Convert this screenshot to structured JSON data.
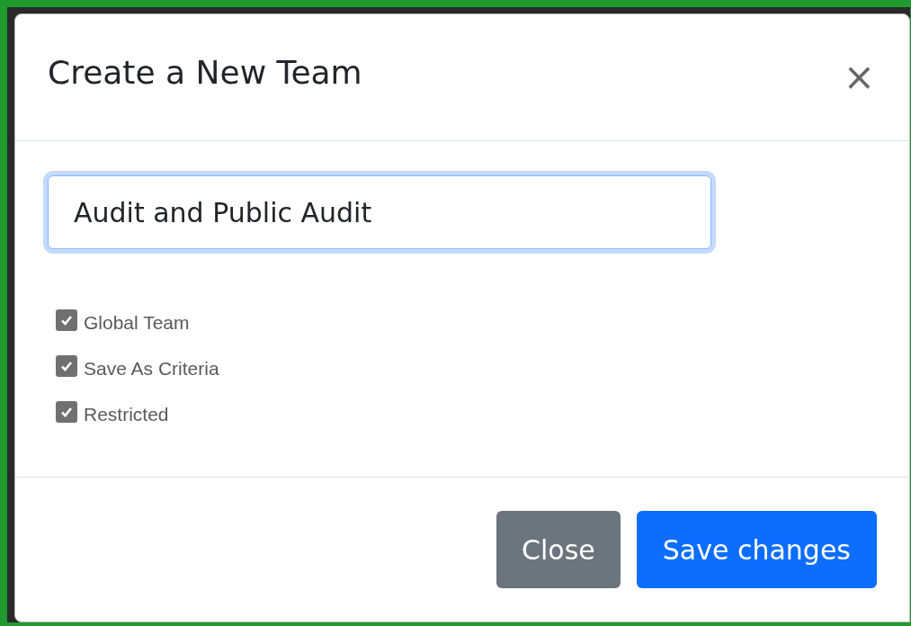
{
  "dialog": {
    "title": "Create a New Team",
    "close_symbol": "×"
  },
  "team_name": {
    "value": "Audit and Public Audit",
    "focused": true
  },
  "options": [
    {
      "label": "Global Team",
      "checked": true
    },
    {
      "label": "Save As Criteria",
      "checked": true
    },
    {
      "label": "Restricted",
      "checked": true
    }
  ],
  "buttons": [
    {
      "label": "Close",
      "kind": "secondary"
    },
    {
      "label": "Save changes",
      "kind": "primary"
    }
  ]
}
